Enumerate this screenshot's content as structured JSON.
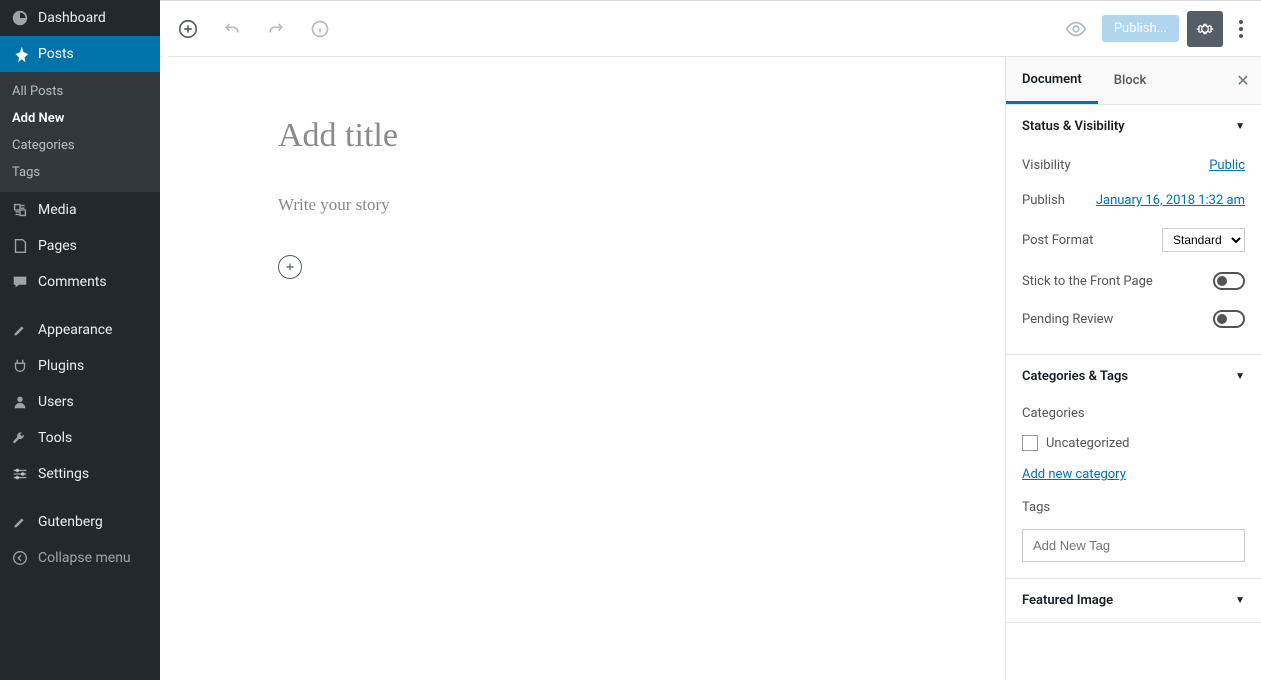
{
  "sidebar": {
    "dashboard": "Dashboard",
    "posts": "Posts",
    "submenu": {
      "all_posts": "All Posts",
      "add_new": "Add New",
      "categories": "Categories",
      "tags": "Tags"
    },
    "media": "Media",
    "pages": "Pages",
    "comments": "Comments",
    "appearance": "Appearance",
    "plugins": "Plugins",
    "users": "Users",
    "tools": "Tools",
    "settings": "Settings",
    "gutenberg": "Gutenberg",
    "collapse": "Collapse menu"
  },
  "topbar": {
    "publish": "Publish..."
  },
  "editor": {
    "title_placeholder": "Add title",
    "story_placeholder": "Write your story"
  },
  "panel": {
    "tabs": {
      "document": "Document",
      "block": "Block"
    },
    "status": {
      "heading": "Status & Visibility",
      "visibility_label": "Visibility",
      "visibility_value": "Public",
      "publish_label": "Publish",
      "publish_value": "January 16, 2018 1:32 am",
      "post_format_label": "Post Format",
      "post_format_value": "Standard",
      "stick_label": "Stick to the Front Page",
      "pending_label": "Pending Review"
    },
    "cats": {
      "heading": "Categories & Tags",
      "categories_label": "Categories",
      "uncategorized": "Uncategorized",
      "add_new_category": "Add new category",
      "tags_label": "Tags",
      "tags_placeholder": "Add New Tag"
    },
    "featured": {
      "heading": "Featured Image"
    }
  }
}
